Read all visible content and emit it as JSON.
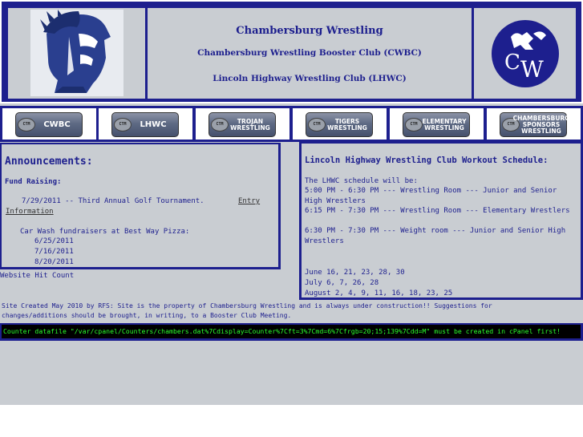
{
  "header": {
    "title": "Chambersburg Wrestling",
    "line2": "Chambersburg Wrestling Booster Club (CWBC)",
    "line3": "Lincoln Highway Wrestling Club (LHWC)",
    "left_logo": "trojan-helmet-logo",
    "right_logo": "cw-logo"
  },
  "nav": {
    "items": [
      {
        "label": "CWBC",
        "icon": "safety-pin-button"
      },
      {
        "label": "LHWC",
        "icon": "safety-pin-button"
      },
      {
        "label": "TROJAN WRESTLING",
        "icon": "safety-pin-button"
      },
      {
        "label": "TIGERS WRESTLING",
        "icon": "safety-pin-button"
      },
      {
        "label": "ELEMENTARY WRESTLING",
        "icon": "safety-pin-button"
      },
      {
        "label": "CHAMBERSBURG SPONSORS WRESTLING",
        "icon": "safety-pin-button"
      }
    ]
  },
  "announcements": {
    "title": "Announcements:",
    "subtitle": "Fund Raising:",
    "item1": "7/29/2011 -- Third Annual Golf Tournament.",
    "item1_link": "Entry",
    "item1_link2": "Information",
    "carwash": "Car Wash fundraisers at Best Way Pizza:",
    "dates": [
      "6/25/2011",
      "7/16/2011",
      "8/20/2011"
    ]
  },
  "hit_count": "Website Hit Count",
  "schedule": {
    "title": "Lincoln Highway Wrestling Club Workout Schedule:",
    "intro": "The LHWC schedule will be:",
    "lines": [
      "5:00 PM - 6:30 PM --- Wrestling Room --- Junior and Senior High Wrestlers",
      "6:15 PM - 7:30 PM --- Wrestling Room --- Elementary Wrestlers",
      "6:30 PM - 7:30 PM --- Weight room --- Junior and Senior High Wrestlers"
    ],
    "months": [
      "June 16, 21, 23, 28, 30",
      "July 6, 7, 26, 28",
      "August 2, 4, 9, 11, 16, 18, 23, 25"
    ]
  },
  "footer": {
    "line1": "Site Created May 2010 by RFS: Site is the property of Chambersburg Wrestling and is always under construction!! Suggestions for",
    "line2": "changes/additions should be brought, in writing, to a Booster Club Meeting."
  },
  "counter_error": "Counter datafile \"/var/cpanel/Counters/chambers.dat%7Cdisplay=Counter%7Cft=3%7Cmd=6%7Cfrgb=20;15;139%7Cdd=M\" must be created in cPanel first!",
  "colors": {
    "navy": "#1d1f8e",
    "panel": "#c9cdd2",
    "counter_text": "#2bff2b"
  }
}
